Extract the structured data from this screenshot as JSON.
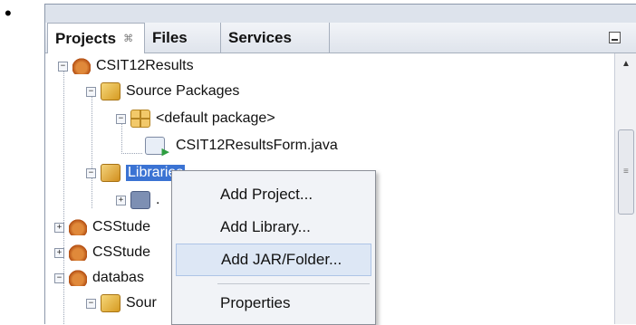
{
  "tabs": [
    {
      "label": "Projects",
      "close": "⌘"
    },
    {
      "label": "Files"
    },
    {
      "label": "Services"
    }
  ],
  "tree": {
    "project1": "CSIT12Results",
    "source_packages": "Source Packages",
    "default_package": "<default package>",
    "java_file": "CSIT12ResultsForm.java",
    "libraries": "Libraries",
    "jdk_item": ".",
    "project2": "CSStude",
    "project3": "CSStude",
    "project4": "databas",
    "source_packages_2": "Sour"
  },
  "context_menu": {
    "items": [
      {
        "label": "Add Project..."
      },
      {
        "label": "Add Library..."
      },
      {
        "label": "Add JAR/Folder..."
      },
      {
        "label": "Properties"
      }
    ]
  },
  "colors": {
    "selection": "#3b73d3",
    "menu_hover": "#dde7f5"
  }
}
